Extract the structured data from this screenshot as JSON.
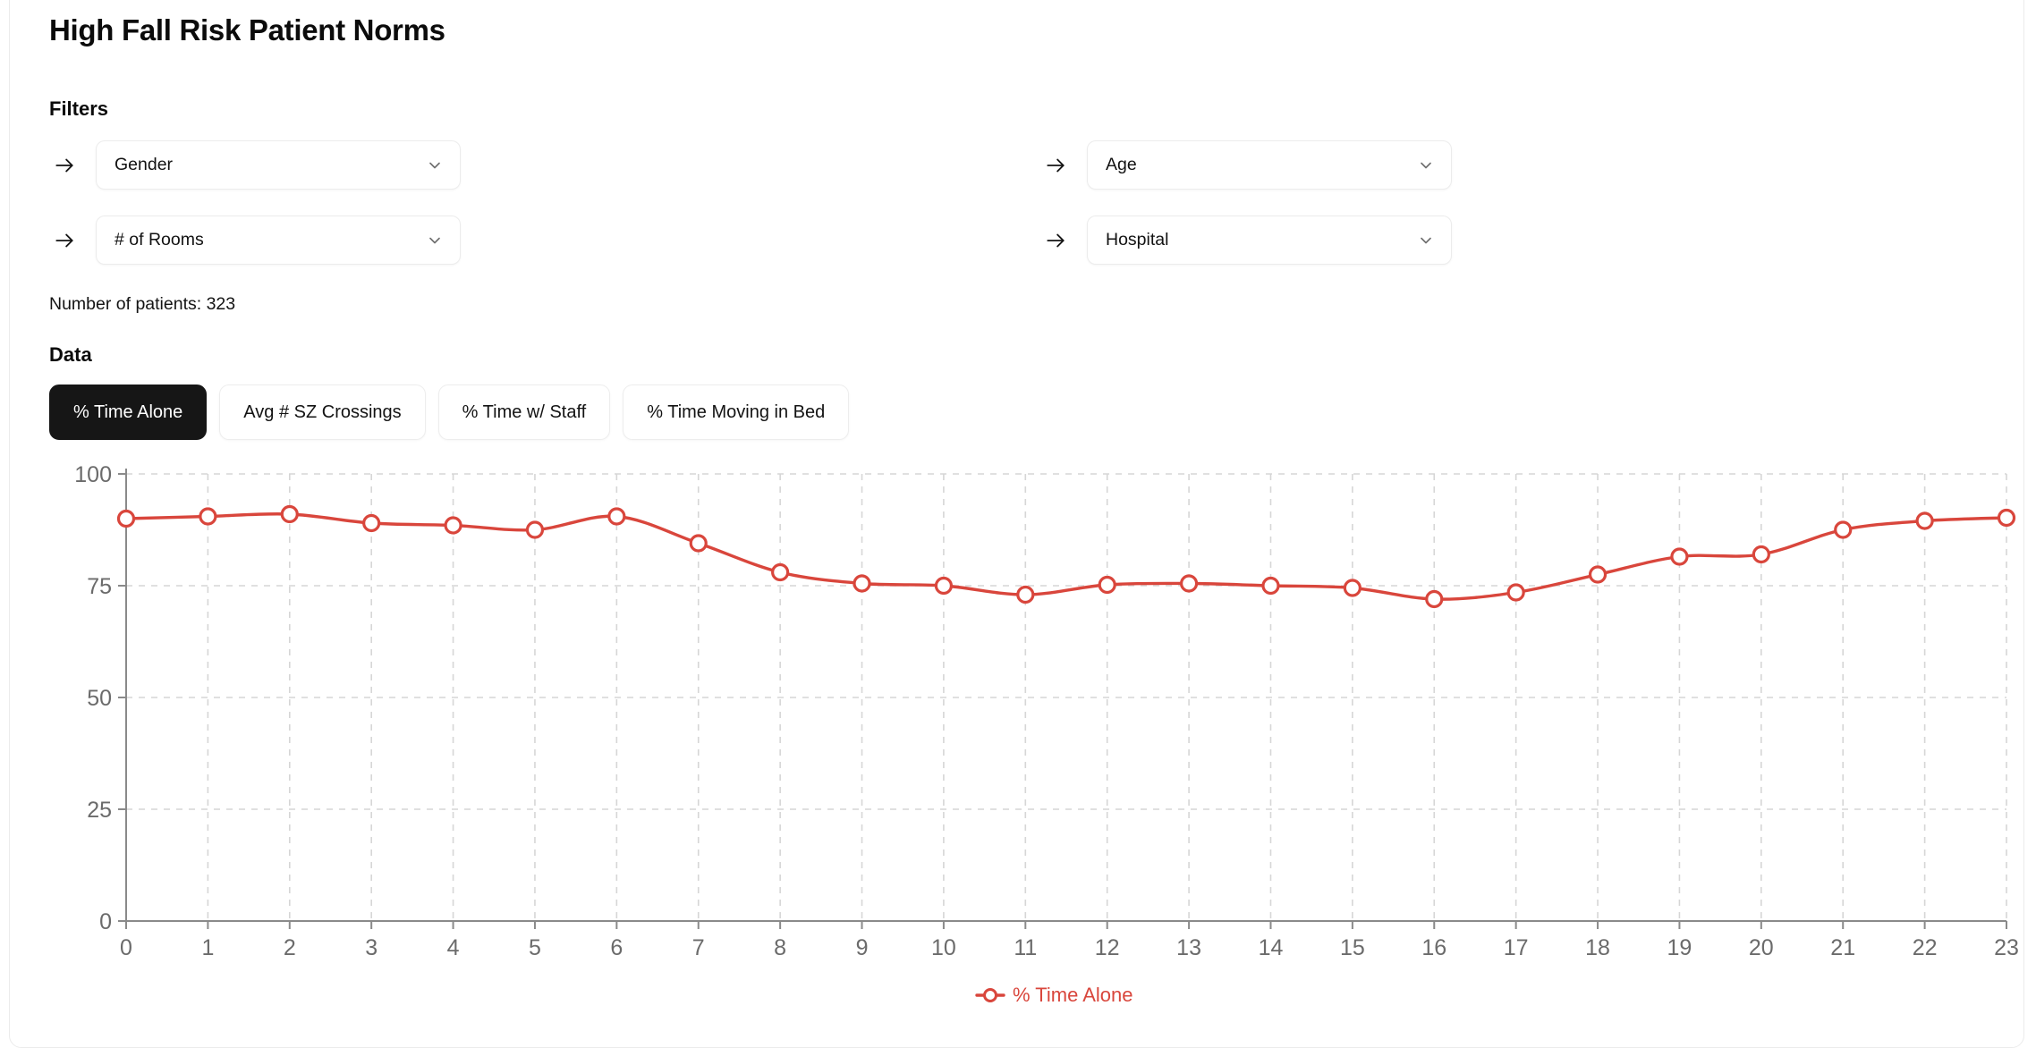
{
  "page": {
    "title": "High Fall Risk Patient Norms"
  },
  "filters": {
    "heading": "Filters",
    "arrow_icon": "arrow-right-icon",
    "chevron_icon": "chevron-down-icon",
    "items": [
      {
        "label": "Gender",
        "name": "gender"
      },
      {
        "label": "# of Rooms",
        "name": "rooms"
      },
      {
        "label": "Age",
        "name": "age"
      },
      {
        "label": "Hospital",
        "name": "hospital"
      }
    ]
  },
  "summary": {
    "patient_count_text": "Number of patients: 323"
  },
  "data_section": {
    "heading": "Data",
    "tabs": [
      {
        "label": "% Time Alone",
        "active": true
      },
      {
        "label": "Avg # SZ Crossings",
        "active": false
      },
      {
        "label": "% Time w/ Staff",
        "active": false
      },
      {
        "label": "% Time Moving in Bed",
        "active": false
      }
    ]
  },
  "chart_data": {
    "type": "line",
    "title": "",
    "xlabel": "",
    "ylabel": "",
    "series_color": "#d9463c",
    "legend": {
      "position": "bottom",
      "entries": [
        "% Time Alone"
      ]
    },
    "grid": true,
    "xlim": [
      0,
      23
    ],
    "ylim": [
      0,
      100
    ],
    "yticks": [
      0,
      25,
      50,
      75,
      100
    ],
    "xticks": [
      0,
      1,
      2,
      3,
      4,
      5,
      6,
      7,
      8,
      9,
      10,
      11,
      12,
      13,
      14,
      15,
      16,
      17,
      18,
      19,
      20,
      21,
      22,
      23
    ],
    "x": [
      0,
      1,
      2,
      3,
      4,
      5,
      6,
      7,
      8,
      9,
      10,
      11,
      12,
      13,
      14,
      15,
      16,
      17,
      18,
      19,
      20,
      21,
      22,
      23
    ],
    "series": [
      {
        "name": "% Time Alone",
        "values": [
          90.0,
          90.5,
          91.0,
          89.0,
          88.5,
          87.5,
          90.5,
          84.5,
          78.0,
          75.5,
          75.0,
          73.0,
          75.2,
          75.5,
          75.0,
          74.5,
          72.0,
          73.5,
          77.5,
          81.5,
          82.0,
          87.5,
          89.5,
          90.2
        ]
      }
    ]
  }
}
